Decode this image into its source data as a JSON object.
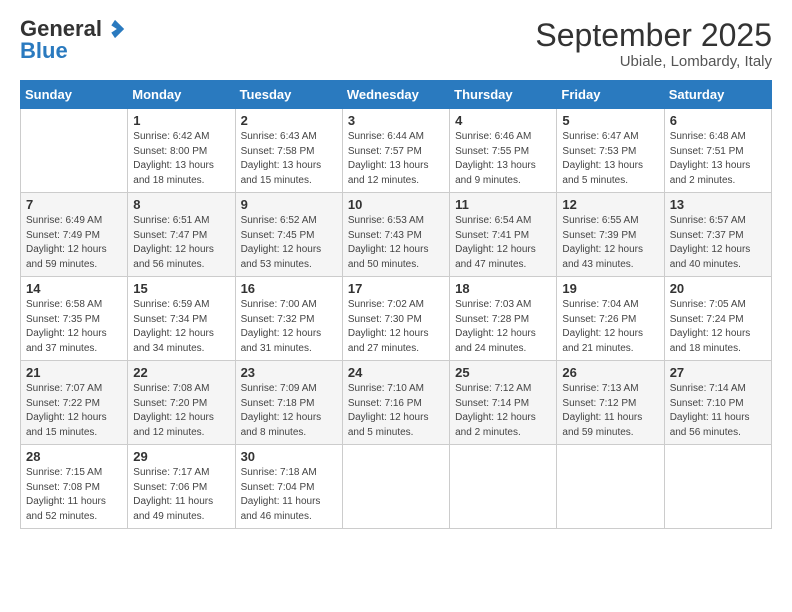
{
  "logo": {
    "general": "General",
    "blue": "Blue",
    "tagline": ""
  },
  "title": "September 2025",
  "subtitle": "Ubiale, Lombardy, Italy",
  "days_header": [
    "Sunday",
    "Monday",
    "Tuesday",
    "Wednesday",
    "Thursday",
    "Friday",
    "Saturday"
  ],
  "weeks": [
    [
      {
        "day": "",
        "info": ""
      },
      {
        "day": "1",
        "info": "Sunrise: 6:42 AM\nSunset: 8:00 PM\nDaylight: 13 hours\nand 18 minutes."
      },
      {
        "day": "2",
        "info": "Sunrise: 6:43 AM\nSunset: 7:58 PM\nDaylight: 13 hours\nand 15 minutes."
      },
      {
        "day": "3",
        "info": "Sunrise: 6:44 AM\nSunset: 7:57 PM\nDaylight: 13 hours\nand 12 minutes."
      },
      {
        "day": "4",
        "info": "Sunrise: 6:46 AM\nSunset: 7:55 PM\nDaylight: 13 hours\nand 9 minutes."
      },
      {
        "day": "5",
        "info": "Sunrise: 6:47 AM\nSunset: 7:53 PM\nDaylight: 13 hours\nand 5 minutes."
      },
      {
        "day": "6",
        "info": "Sunrise: 6:48 AM\nSunset: 7:51 PM\nDaylight: 13 hours\nand 2 minutes."
      }
    ],
    [
      {
        "day": "7",
        "info": "Sunrise: 6:49 AM\nSunset: 7:49 PM\nDaylight: 12 hours\nand 59 minutes."
      },
      {
        "day": "8",
        "info": "Sunrise: 6:51 AM\nSunset: 7:47 PM\nDaylight: 12 hours\nand 56 minutes."
      },
      {
        "day": "9",
        "info": "Sunrise: 6:52 AM\nSunset: 7:45 PM\nDaylight: 12 hours\nand 53 minutes."
      },
      {
        "day": "10",
        "info": "Sunrise: 6:53 AM\nSunset: 7:43 PM\nDaylight: 12 hours\nand 50 minutes."
      },
      {
        "day": "11",
        "info": "Sunrise: 6:54 AM\nSunset: 7:41 PM\nDaylight: 12 hours\nand 47 minutes."
      },
      {
        "day": "12",
        "info": "Sunrise: 6:55 AM\nSunset: 7:39 PM\nDaylight: 12 hours\nand 43 minutes."
      },
      {
        "day": "13",
        "info": "Sunrise: 6:57 AM\nSunset: 7:37 PM\nDaylight: 12 hours\nand 40 minutes."
      }
    ],
    [
      {
        "day": "14",
        "info": "Sunrise: 6:58 AM\nSunset: 7:35 PM\nDaylight: 12 hours\nand 37 minutes."
      },
      {
        "day": "15",
        "info": "Sunrise: 6:59 AM\nSunset: 7:34 PM\nDaylight: 12 hours\nand 34 minutes."
      },
      {
        "day": "16",
        "info": "Sunrise: 7:00 AM\nSunset: 7:32 PM\nDaylight: 12 hours\nand 31 minutes."
      },
      {
        "day": "17",
        "info": "Sunrise: 7:02 AM\nSunset: 7:30 PM\nDaylight: 12 hours\nand 27 minutes."
      },
      {
        "day": "18",
        "info": "Sunrise: 7:03 AM\nSunset: 7:28 PM\nDaylight: 12 hours\nand 24 minutes."
      },
      {
        "day": "19",
        "info": "Sunrise: 7:04 AM\nSunset: 7:26 PM\nDaylight: 12 hours\nand 21 minutes."
      },
      {
        "day": "20",
        "info": "Sunrise: 7:05 AM\nSunset: 7:24 PM\nDaylight: 12 hours\nand 18 minutes."
      }
    ],
    [
      {
        "day": "21",
        "info": "Sunrise: 7:07 AM\nSunset: 7:22 PM\nDaylight: 12 hours\nand 15 minutes."
      },
      {
        "day": "22",
        "info": "Sunrise: 7:08 AM\nSunset: 7:20 PM\nDaylight: 12 hours\nand 12 minutes."
      },
      {
        "day": "23",
        "info": "Sunrise: 7:09 AM\nSunset: 7:18 PM\nDaylight: 12 hours\nand 8 minutes."
      },
      {
        "day": "24",
        "info": "Sunrise: 7:10 AM\nSunset: 7:16 PM\nDaylight: 12 hours\nand 5 minutes."
      },
      {
        "day": "25",
        "info": "Sunrise: 7:12 AM\nSunset: 7:14 PM\nDaylight: 12 hours\nand 2 minutes."
      },
      {
        "day": "26",
        "info": "Sunrise: 7:13 AM\nSunset: 7:12 PM\nDaylight: 11 hours\nand 59 minutes."
      },
      {
        "day": "27",
        "info": "Sunrise: 7:14 AM\nSunset: 7:10 PM\nDaylight: 11 hours\nand 56 minutes."
      }
    ],
    [
      {
        "day": "28",
        "info": "Sunrise: 7:15 AM\nSunset: 7:08 PM\nDaylight: 11 hours\nand 52 minutes."
      },
      {
        "day": "29",
        "info": "Sunrise: 7:17 AM\nSunset: 7:06 PM\nDaylight: 11 hours\nand 49 minutes."
      },
      {
        "day": "30",
        "info": "Sunrise: 7:18 AM\nSunset: 7:04 PM\nDaylight: 11 hours\nand 46 minutes."
      },
      {
        "day": "",
        "info": ""
      },
      {
        "day": "",
        "info": ""
      },
      {
        "day": "",
        "info": ""
      },
      {
        "day": "",
        "info": ""
      }
    ]
  ]
}
